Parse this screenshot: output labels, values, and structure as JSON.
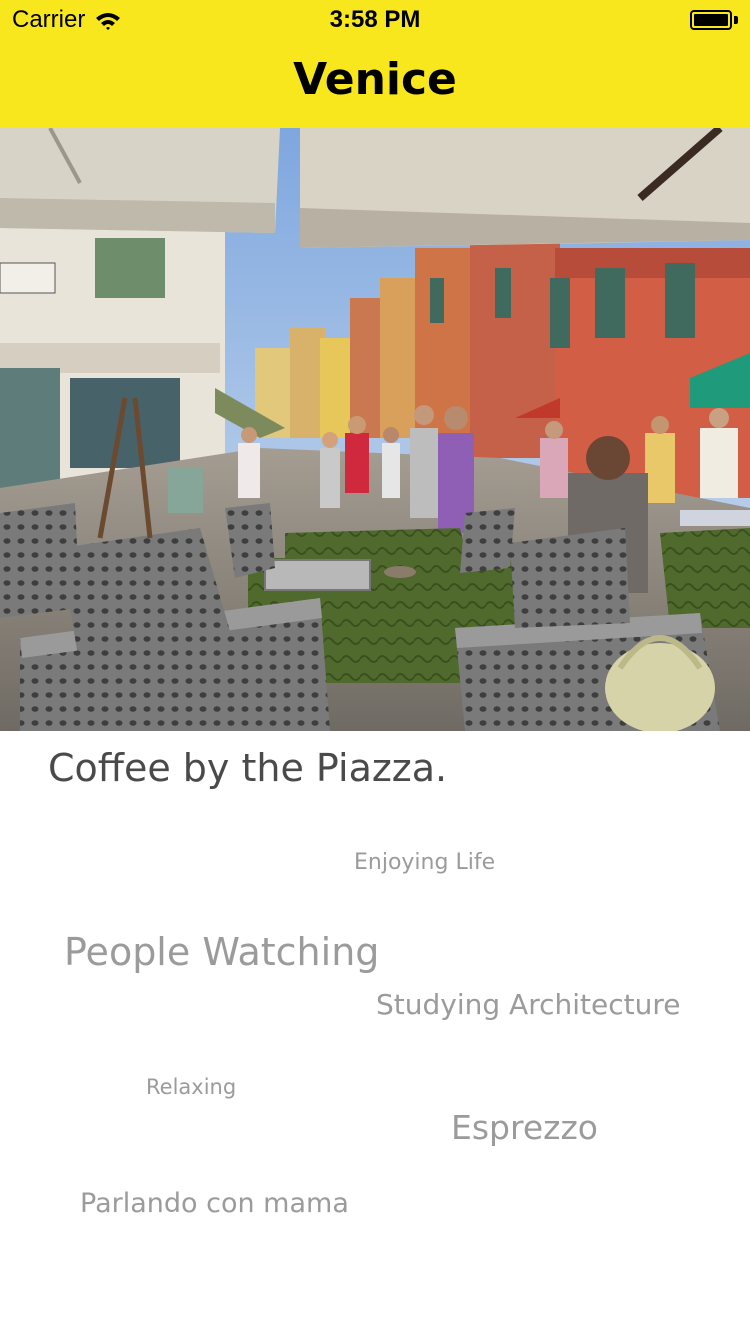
{
  "status_bar": {
    "carrier": "Carrier",
    "time": "3:58 PM",
    "battery_level": 1.0
  },
  "nav": {
    "title": "Venice",
    "background_color": "#f8e71c"
  },
  "hero": {
    "description_icon": "photo"
  },
  "caption": "Coffee by the Piazza.",
  "tags": [
    "Enjoying Life",
    "People Watching",
    "Studying Architecture",
    "Relaxing",
    "Esprezzo",
    "Parlando con mama"
  ],
  "colors": {
    "caption_text": "#4a4a4a",
    "tag_text": "#9b9b9b"
  }
}
